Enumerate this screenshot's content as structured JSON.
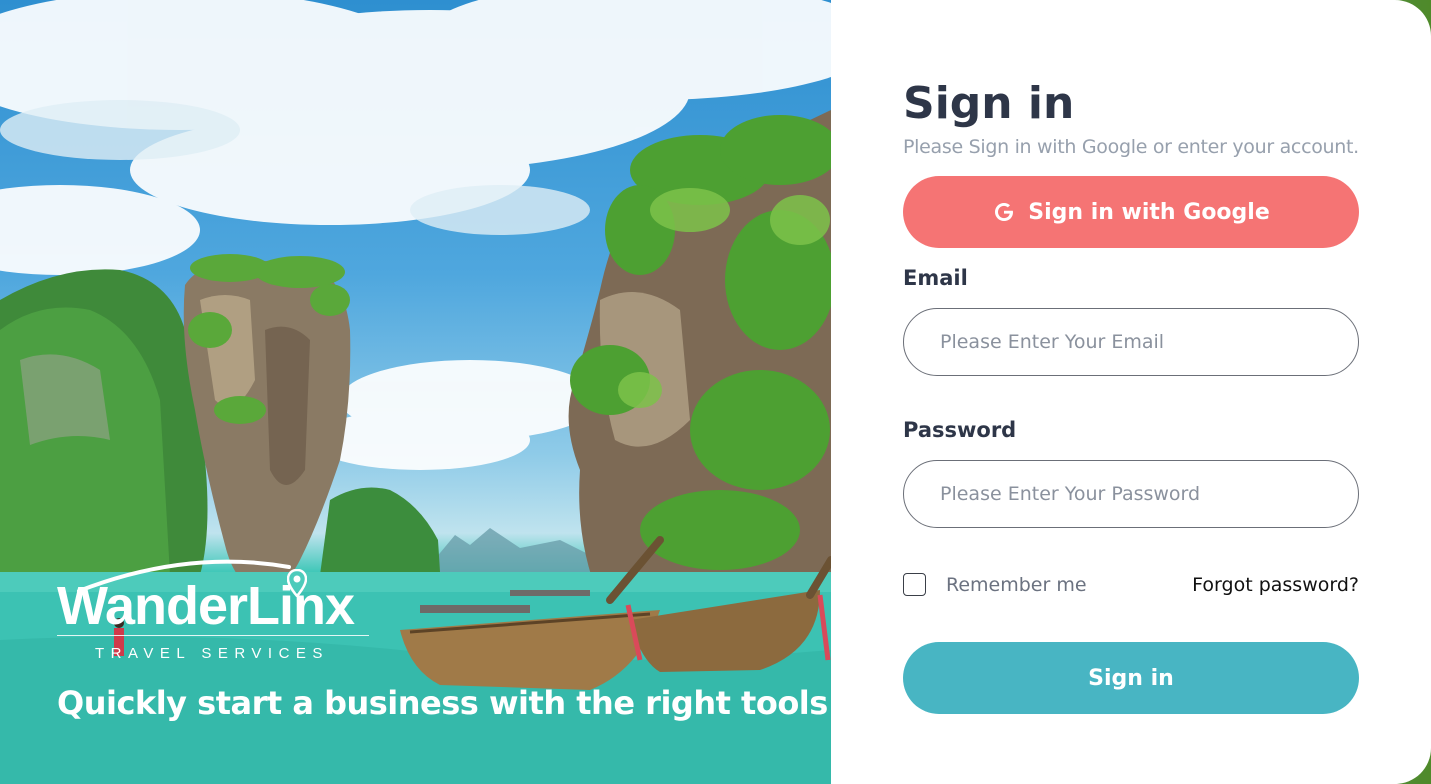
{
  "colors": {
    "google_button": "#f57474",
    "signin_button": "#48b5c3",
    "heading": "#2e3648",
    "subtitle": "#97a0ad",
    "panel_background": "#ffffff"
  },
  "hero": {
    "brand_name": "WanderLinx",
    "brand_subtitle": "TRAVEL SERVICES",
    "tagline": "Quickly start a business with the right tools.",
    "image_description_icon": "tropical-islands-scene"
  },
  "signin": {
    "title": "Sign in",
    "subtitle": "Please Sign in with Google or enter your account.",
    "google_button_label": "Sign in with Google",
    "google_icon": "google-g-icon",
    "email_label": "Email",
    "email_placeholder": "Please Enter Your Email",
    "email_value": "",
    "password_label": "Password",
    "password_placeholder": "Please Enter Your Password",
    "password_value": "",
    "remember_label": "Remember me",
    "remember_checked": false,
    "forgot_label": "Forgot password?",
    "submit_label": "Sign in"
  }
}
